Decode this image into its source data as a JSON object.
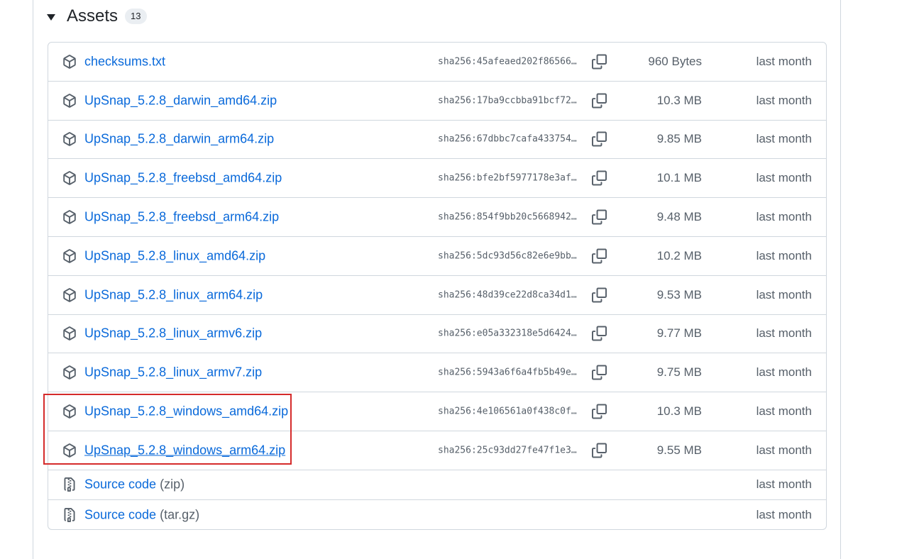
{
  "assets": {
    "title": "Assets",
    "count": "13",
    "files": [
      {
        "name": "checksums.txt",
        "sha": "sha256:45afeaed202f86566…",
        "size": "960 Bytes",
        "date": "last month"
      },
      {
        "name": "UpSnap_5.2.8_darwin_amd64.zip",
        "sha": "sha256:17ba9ccbba91bcf72…",
        "size": "10.3 MB",
        "date": "last month"
      },
      {
        "name": "UpSnap_5.2.8_darwin_arm64.zip",
        "sha": "sha256:67dbbc7cafa433754…",
        "size": "9.85 MB",
        "date": "last month"
      },
      {
        "name": "UpSnap_5.2.8_freebsd_amd64.zip",
        "sha": "sha256:bfe2bf5977178e3af…",
        "size": "10.1 MB",
        "date": "last month"
      },
      {
        "name": "UpSnap_5.2.8_freebsd_arm64.zip",
        "sha": "sha256:854f9bb20c5668942…",
        "size": "9.48 MB",
        "date": "last month"
      },
      {
        "name": "UpSnap_5.2.8_linux_amd64.zip",
        "sha": "sha256:5dc93d56c82e6e9bb…",
        "size": "10.2 MB",
        "date": "last month"
      },
      {
        "name": "UpSnap_5.2.8_linux_arm64.zip",
        "sha": "sha256:48d39ce22d8ca34d1…",
        "size": "9.53 MB",
        "date": "last month"
      },
      {
        "name": "UpSnap_5.2.8_linux_armv6.zip",
        "sha": "sha256:e05a332318e5d6424…",
        "size": "9.77 MB",
        "date": "last month"
      },
      {
        "name": "UpSnap_5.2.8_linux_armv7.zip",
        "sha": "sha256:5943a6f6a4fb5b49e…",
        "size": "9.75 MB",
        "date": "last month"
      },
      {
        "name": "UpSnap_5.2.8_windows_amd64.zip",
        "sha": "sha256:4e106561a0f438c0f…",
        "size": "10.3 MB",
        "date": "last month"
      },
      {
        "name": "UpSnap_5.2.8_windows_arm64.zip",
        "sha": "sha256:25c93dd27fe47f1e3…",
        "size": "9.55 MB",
        "date": "last month"
      }
    ],
    "source": [
      {
        "label": "Source code",
        "format": "(zip)",
        "date": "last month"
      },
      {
        "label": "Source code",
        "format": "(tar.gz)",
        "date": "last month"
      }
    ]
  },
  "colors": {
    "link": "#0969da",
    "muted": "#57606a",
    "highlight": "#d52b2b"
  }
}
